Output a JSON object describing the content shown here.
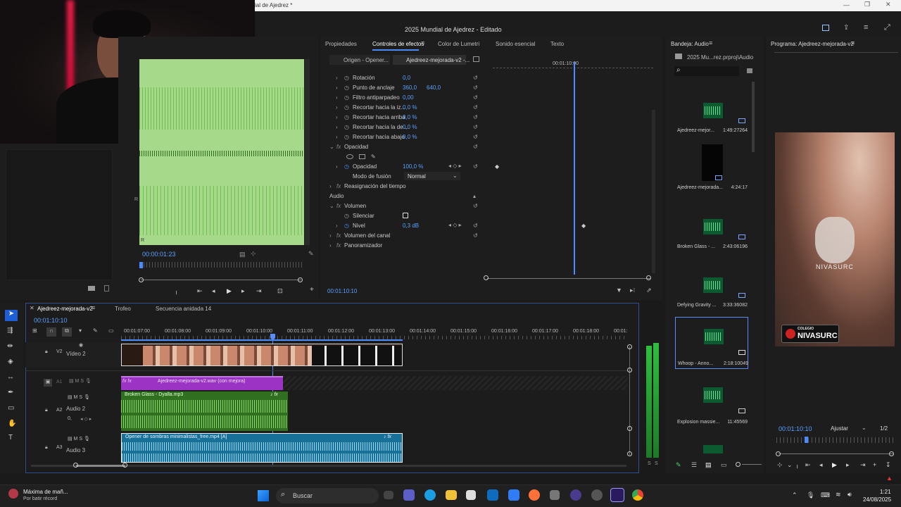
{
  "window": {
    "title_partial": "ial de Ajedrez *",
    "header_title": "2025 Mundial de Ajedrez - Editado"
  },
  "source_monitor": {
    "timecode": "00:00:01:23"
  },
  "effects_tabs": [
    "Propiedades",
    "Controles de efectos",
    "Color de Lumetri",
    "Sonido esencial",
    "Texto"
  ],
  "effects": {
    "source_label": "Origen - Opener...",
    "clip_label": "Ajedreez-mejorada-v2 -...",
    "ruler_time": "00:01:10:00",
    "rows": [
      {
        "name": "Rotación",
        "value": "0,0",
        "value2": ""
      },
      {
        "name": "Punto de anclaje",
        "value": "360,0",
        "value2": "640,0"
      },
      {
        "name": "Filtro antiparpadeo",
        "value": "0,00",
        "value2": ""
      },
      {
        "name": "Recortar hacia la iz...",
        "value": "0,0 %",
        "value2": ""
      },
      {
        "name": "Recortar hacia arriba",
        "value": "0,0 %",
        "value2": ""
      },
      {
        "name": "Recortar hacia la de...",
        "value": "0,0 %",
        "value2": ""
      },
      {
        "name": "Recortar hacia abajo",
        "value": "0,0 %",
        "value2": ""
      }
    ],
    "opacity_group": "Opacidad",
    "opacity_label": "Opacidad",
    "opacity_value": "100,0 %",
    "blend_label": "Modo de fusión",
    "blend_value": "Normal",
    "time_remap": "Reasignación del tiempo",
    "audio_header": "Audio",
    "volume_group": "Volumen",
    "mute_label": "Silenciar",
    "level_label": "Nivel",
    "level_value": "0,3 dB",
    "channel_volume": "Volumen del canal",
    "panner": "Panoramizador",
    "footer_time": "00:01:10:10"
  },
  "audio_bin": {
    "title": "Bandeja: Audio",
    "project": "2025 Mu...rez.prproj\\Audio",
    "items": [
      {
        "name": "Ajedreez-mejor...",
        "duration": "1:49:27264"
      },
      {
        "name": "Ajedreez-mejorada...",
        "duration": "4:24:17"
      },
      {
        "name": "Broken Glass - ...",
        "duration": "2:43:06196"
      },
      {
        "name": "Defying Gravity ...",
        "duration": "3:33:36082"
      },
      {
        "name": "Whoop - Anno...",
        "duration": "2:18:10049"
      },
      {
        "name": "Explosion massie...",
        "duration": "11:45569"
      }
    ]
  },
  "program": {
    "title": "Programa: Ajedreez-mejorada-v2",
    "timecode": "00:01:10:10",
    "zoom": "Ajustar",
    "resolution": "1/2",
    "watermark": "NIVASURC",
    "logo_small": "COLEGIO",
    "logo_big": "NIVASURC"
  },
  "timeline": {
    "tabs": [
      "Ajedreez-mejorada-v2",
      "Trofeo",
      "Secuencia anidada 14"
    ],
    "timecode": "00:01:10:10",
    "ruler": [
      "00:01:07:00",
      "00:01:08:00",
      "00:01:09:00",
      "00:01:10:00",
      "00:01:11:00",
      "00:01:12:00",
      "00:01:13:00",
      "00:01:14:00",
      "00:01:15:00",
      "00:01:16:00",
      "00:01:17:00",
      "00:01:18:00",
      "00:01:"
    ],
    "tracks": {
      "v2": "V2",
      "v2_name": "Vídeo 2",
      "a1": "A1",
      "a2": "A2",
      "a2_name": "Audio 2",
      "a3": "A3",
      "a3_name": "Audio 3",
      "a2_vol": "0,"
    },
    "clips": {
      "a1": "Ajedreez-mejorada-v2.wav (con mejora)",
      "a2": "Broken Glass - Dyalla.mp3",
      "a3": "Opener de sombras minimalistas_free.mp4 [A]"
    }
  },
  "meter": {
    "labels": [
      "S",
      "S"
    ]
  },
  "taskbar": {
    "notif_title": "Máxima de mañ...",
    "notif_sub": "Por batir récord",
    "search": "Buscar",
    "time": "1:21",
    "date": "24/08/2025"
  }
}
